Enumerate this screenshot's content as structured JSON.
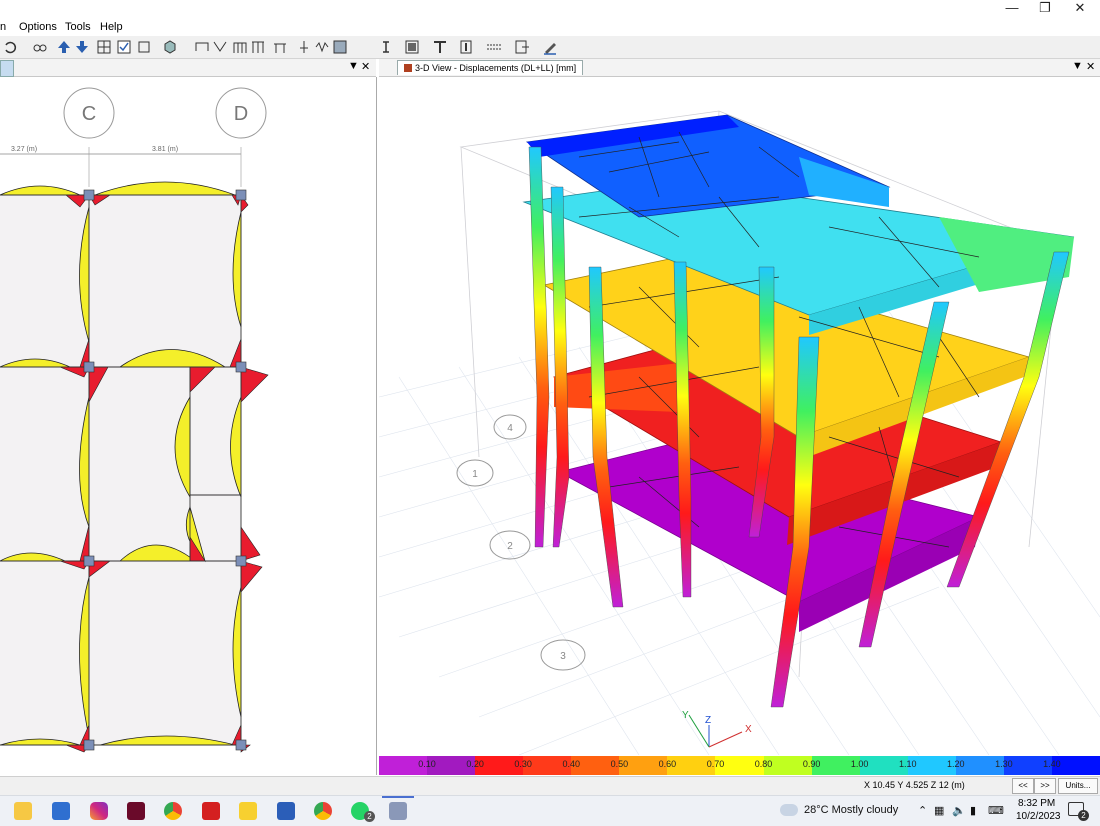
{
  "menu": [
    "n",
    "Options",
    "Tools",
    "Help"
  ],
  "left_pane": {
    "grid_labels": [
      "C",
      "D"
    ],
    "dim_labels": [
      "3.27 (m)",
      "3.81 (m)"
    ]
  },
  "right_pane": {
    "tab_title": "3-D View  - Displacements (DL+LL)  [mm]",
    "grid_bubbles": [
      "1",
      "2",
      "3",
      "4"
    ],
    "axes": [
      "X",
      "Y",
      "Z"
    ]
  },
  "legend": {
    "ticks": [
      "0.10",
      "0.20",
      "0.30",
      "0.40",
      "0.50",
      "0.60",
      "0.70",
      "0.80",
      "0.90",
      "1.00",
      "1.10",
      "1.20",
      "1.30",
      "1.40"
    ],
    "colors": [
      "#c020d8",
      "#a21ac0",
      "#ff1a1a",
      "#ff3a1a",
      "#ff6010",
      "#ffa010",
      "#ffd010",
      "#ffff10",
      "#c0ff20",
      "#40f060",
      "#20e0c0",
      "#20c8ff",
      "#2090ff",
      "#1040ff",
      "#0010ff"
    ]
  },
  "status": {
    "coords": "X 10.45  Y 4.525  Z 12 (m)",
    "nav_prev": "<<",
    "nav_next": ">>",
    "units_button": "Units..."
  },
  "taskbar": {
    "weather": "28°C  Mostly cloudy",
    "time": "8:32 PM",
    "date": "10/2/2023",
    "notification_count": "2",
    "whatsapp_badge": "2"
  }
}
